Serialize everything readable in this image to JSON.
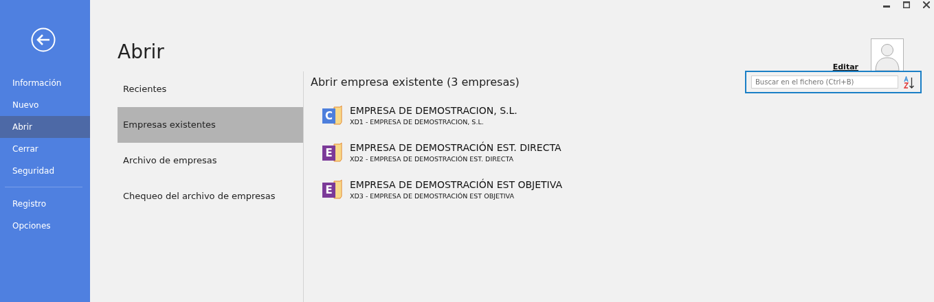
{
  "sidebar": {
    "groups": [
      {
        "items": [
          {
            "label": "Información",
            "selected": false
          },
          {
            "label": "Nuevo",
            "selected": false
          },
          {
            "label": "Abrir",
            "selected": true
          },
          {
            "label": "Cerrar",
            "selected": false
          },
          {
            "label": "Seguridad",
            "selected": false
          }
        ]
      },
      {
        "items": [
          {
            "label": "Registro",
            "selected": false
          },
          {
            "label": "Opciones",
            "selected": false
          }
        ]
      }
    ]
  },
  "page_title": "Abrir",
  "nav": {
    "items": [
      {
        "label": "Recientes",
        "selected": false
      },
      {
        "label": "Empresas existentes",
        "selected": true
      },
      {
        "label": "Archivo de empresas",
        "selected": false
      },
      {
        "label": "Chequeo del archivo de empresas",
        "selected": false
      }
    ]
  },
  "section_title": "Abrir empresa existente  (3 empresas)",
  "user": {
    "edit_link": "Editar"
  },
  "search": {
    "placeholder": "Buscar en el fichero (Ctrl+B)"
  },
  "companies": [
    {
      "badge": "C",
      "color": "#4d7fdc",
      "name": "EMPRESA DE DEMOSTRACION, S.L.",
      "detail": "XD1 - EMPRESA DE DEMOSTRACION, S.L."
    },
    {
      "badge": "E",
      "color": "#7b3a98",
      "name": "EMPRESA DE DEMOSTRACIÓN EST. DIRECTA",
      "detail": "XD2 - EMPRESA DE DEMOSTRACIÓN EST. DIRECTA"
    },
    {
      "badge": "E",
      "color": "#7b3a98",
      "name": "EMPRESA DE DEMOSTRACIÓN EST OBJETIVA",
      "detail": "XD3 - EMPRESA DE DEMOSTRACIÓN EST OBJETIVA"
    }
  ]
}
